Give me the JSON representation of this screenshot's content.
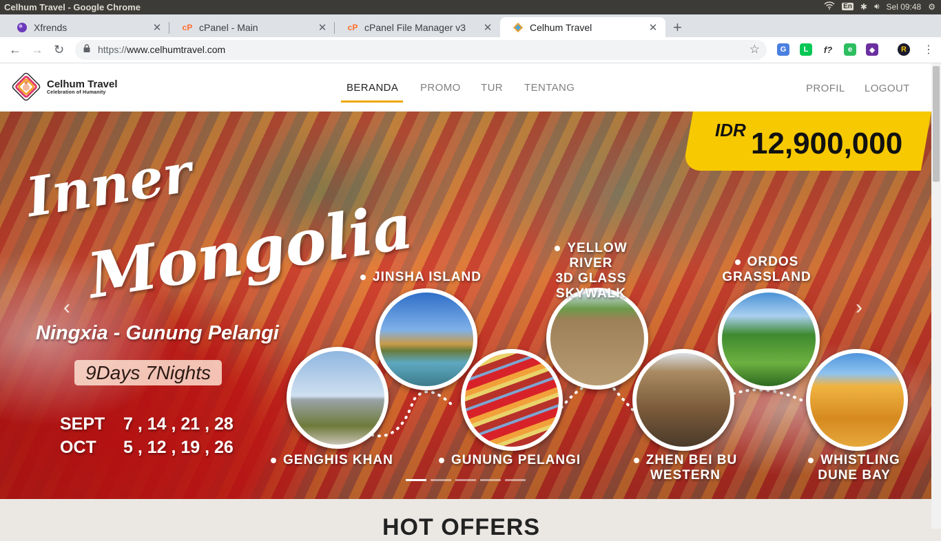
{
  "os": {
    "window_title": "Celhum Travel - Google Chrome",
    "keyboard": "En",
    "clock": "Sel 09:48"
  },
  "tabs": [
    {
      "label": "Xfrends"
    },
    {
      "label": "cPanel - Main"
    },
    {
      "label": "cPanel File Manager v3"
    },
    {
      "label": "Celhum Travel"
    }
  ],
  "address": {
    "scheme": "https://",
    "host": "www.celhumtravel.com"
  },
  "site": {
    "brand": "Celhum Travel",
    "tagline": "Celebration of Humanity",
    "nav": [
      "BERANDA",
      "PROMO",
      "TUR",
      "TENTANG"
    ],
    "nav_right": [
      "PROFIL",
      "LOGOUT"
    ],
    "accent_color": "#f0a800"
  },
  "hero": {
    "price_currency": "IDR",
    "price_amount": "12,900,000",
    "title_line1": "Inner",
    "title_line2": "Mongolia",
    "subtitle": "Ningxia - Gunung Pelangi",
    "duration": "9Days 7Nights",
    "schedule": [
      {
        "month": "SEPT",
        "days": "7 , 14 , 21 , 28"
      },
      {
        "month": "OCT",
        "days": "5 , 12 , 19 , 26"
      }
    ],
    "destinations": {
      "genghis": "GENGHIS KHAN",
      "jinsha": "JINSHA ISLAND",
      "pelangi": "GUNUNG PELANGI",
      "yellow": "YELLOW RIVER\n3D GLASS\nSKYWALK",
      "zhen": "ZHEN BEI BU\nWESTERN",
      "ordos": "ORDOS\nGRASSLAND",
      "whistling": "WHISTLING\nDUNE BAY"
    },
    "slide_count": 5,
    "active_slide": 1,
    "price_badge_color": "#f7c900"
  },
  "section": {
    "hot_offers": "HOT OFFERS"
  }
}
